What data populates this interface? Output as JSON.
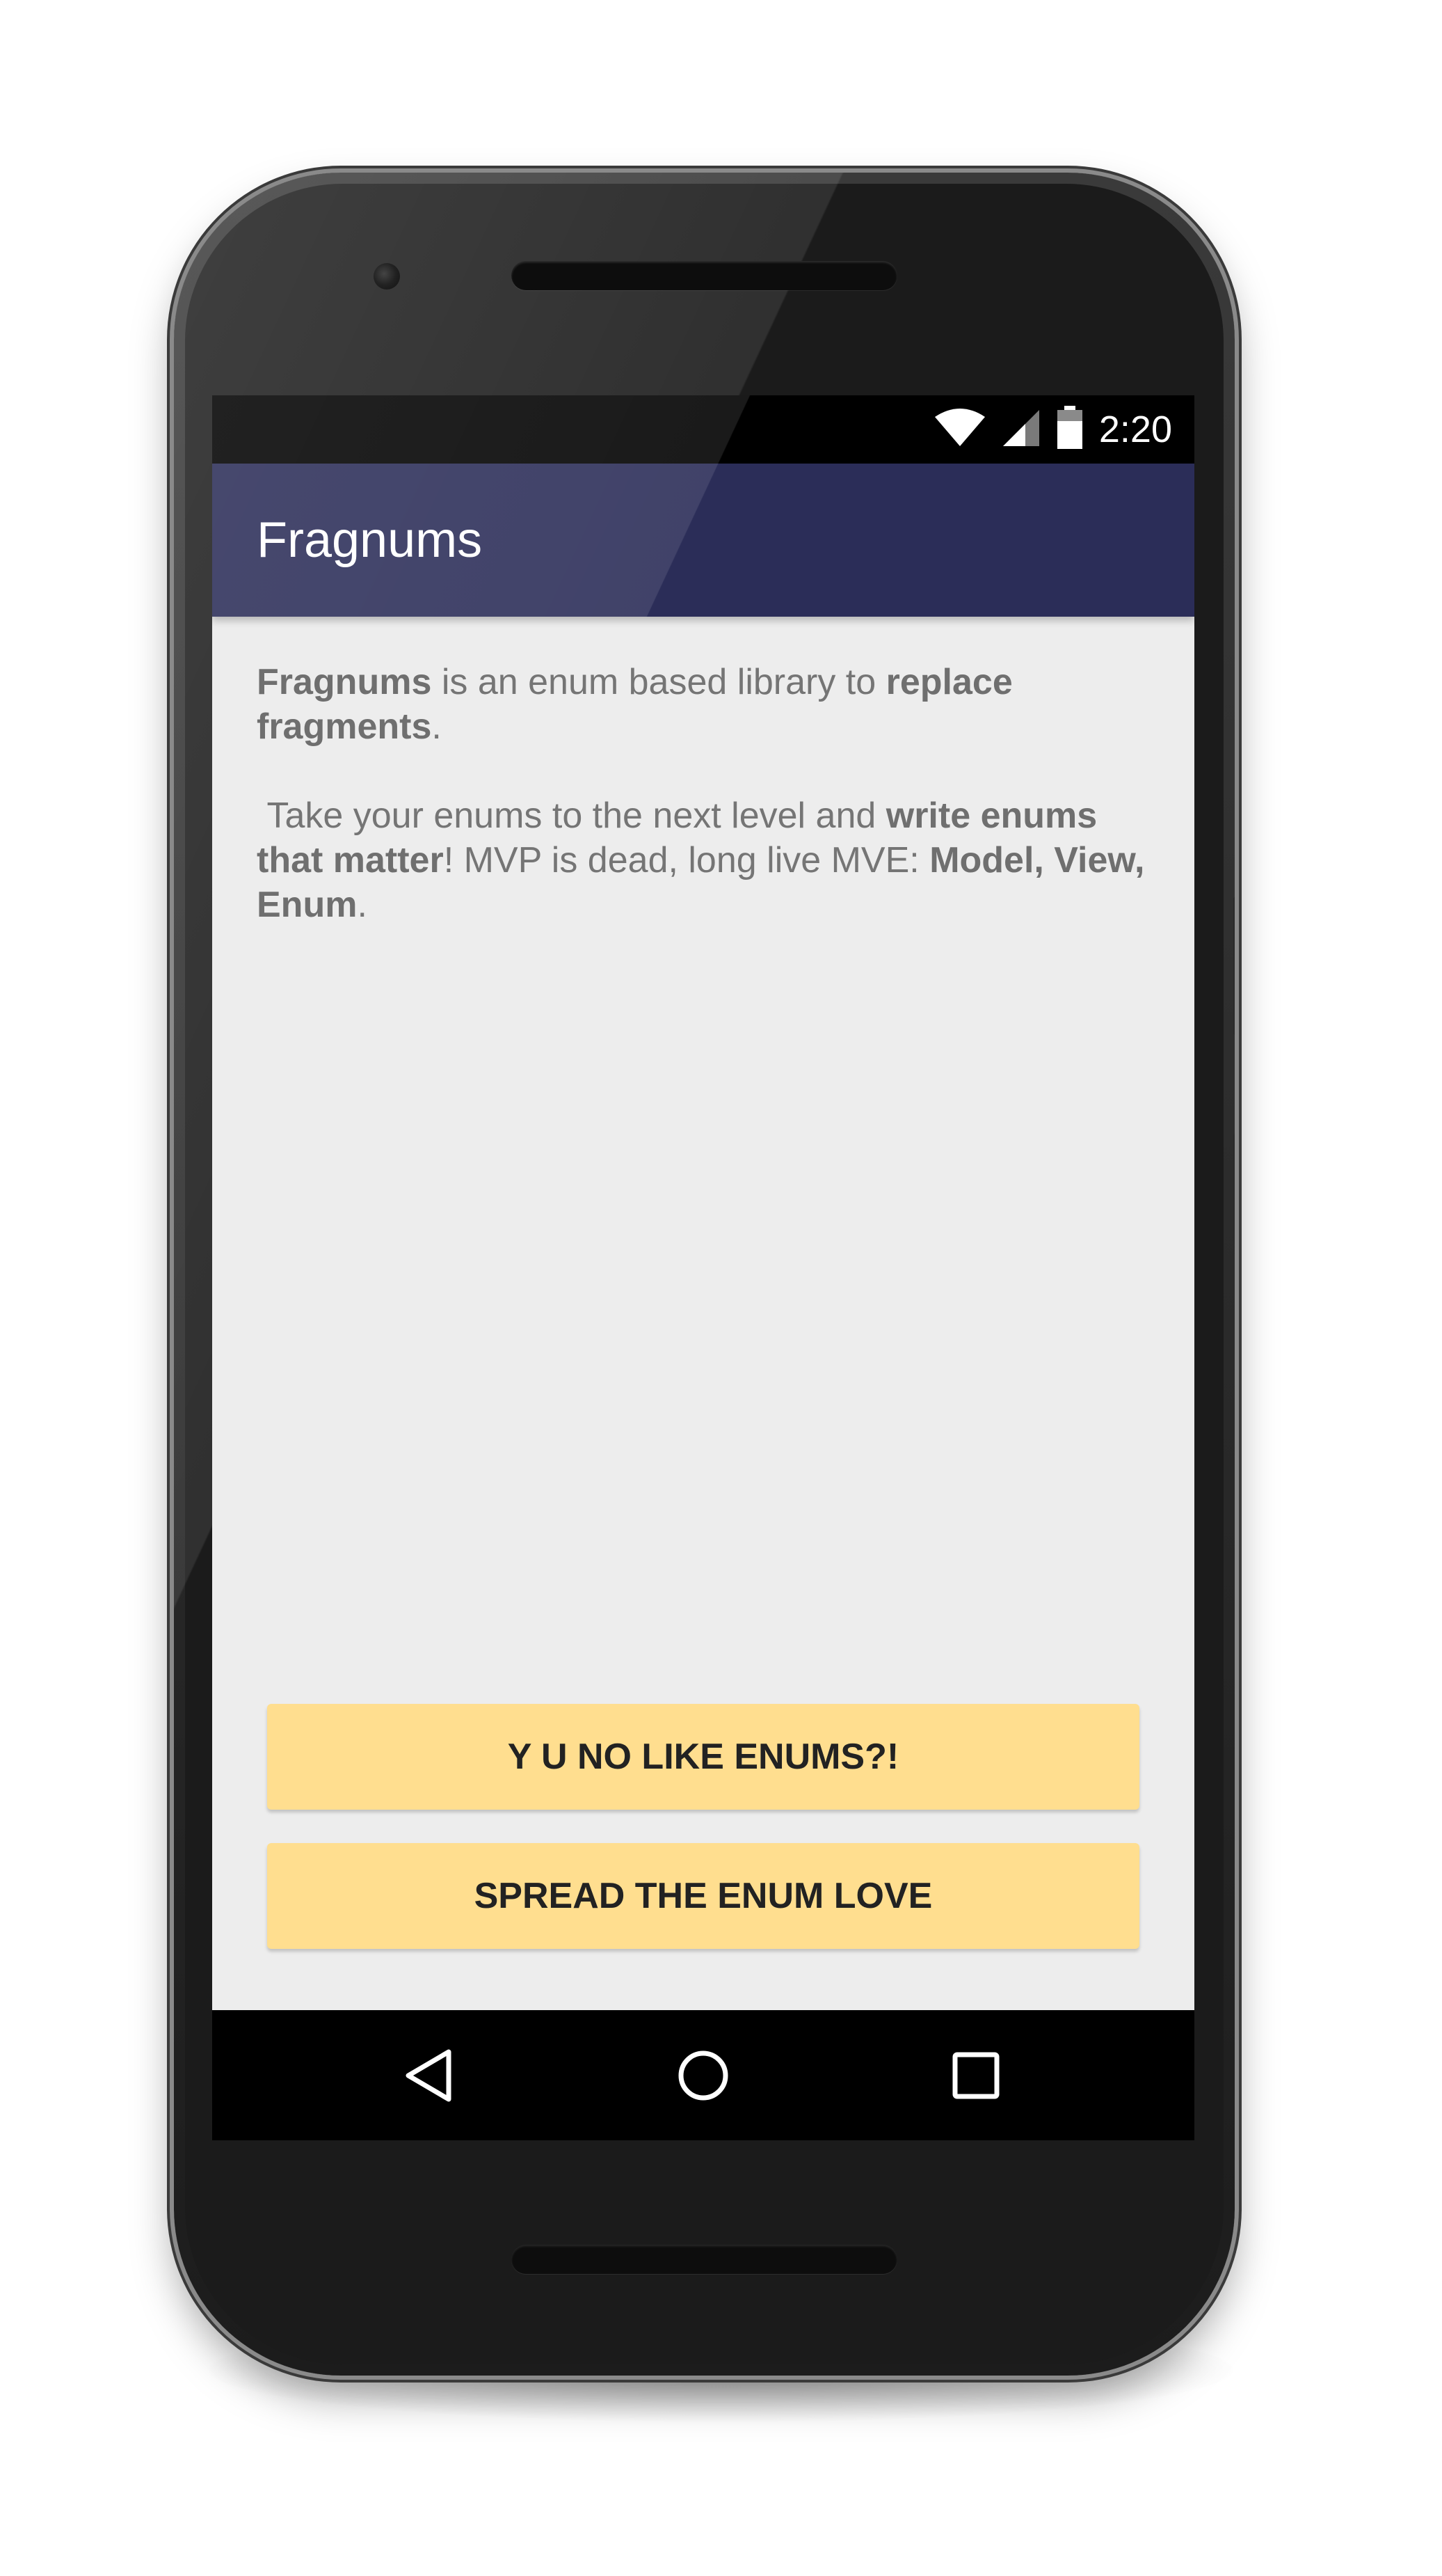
{
  "status_bar": {
    "time": "2:20",
    "icons": [
      "wifi-icon",
      "cell-signal-icon",
      "battery-icon"
    ]
  },
  "app_bar": {
    "title": "Fragnums",
    "color": "#2b2d58"
  },
  "content": {
    "paragraph_1": [
      {
        "text": "Fragnums",
        "bold": true
      },
      {
        "text": " is an enum based library to ",
        "bold": false
      },
      {
        "text": "replace fragments",
        "bold": true
      },
      {
        "text": ".",
        "bold": false
      }
    ],
    "paragraph_2": [
      {
        "text": " Take your enums to the next level and ",
        "bold": false
      },
      {
        "text": "write enums that matter",
        "bold": true
      },
      {
        "text": "! MVP is dead, long live MVE: ",
        "bold": false
      },
      {
        "text": "Model, View, Enum",
        "bold": true
      },
      {
        "text": ".",
        "bold": false
      }
    ]
  },
  "buttons": {
    "primary_label": "Y U NO LIKE ENUMS?!",
    "secondary_label": "SPREAD THE ENUM LOVE",
    "color": "#ffde8f"
  },
  "nav_bar": {
    "icons": [
      "back-icon",
      "home-icon",
      "recents-icon"
    ]
  }
}
